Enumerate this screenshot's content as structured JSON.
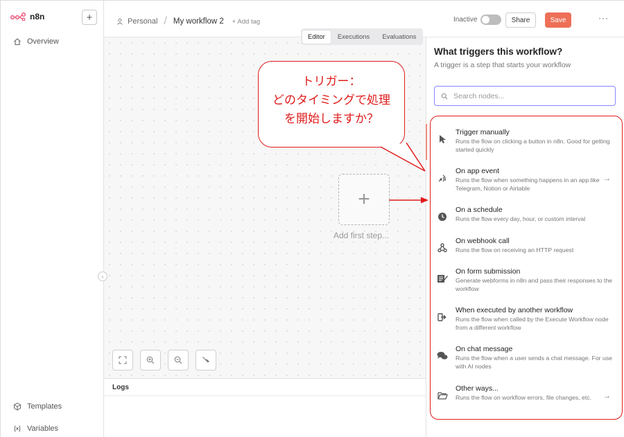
{
  "app": {
    "logo_text": "n8n"
  },
  "sidebar": {
    "items": [
      {
        "label": "Overview"
      },
      {
        "label": "Templates"
      },
      {
        "label": "Variables"
      }
    ]
  },
  "header": {
    "breadcrumb_owner": "Personal",
    "workflow_name": "My workflow 2",
    "add_tag": "+ Add tag",
    "status_label": "Inactive",
    "share_label": "Share",
    "save_label": "Save",
    "more_label": "···"
  },
  "tabs": [
    {
      "label": "Editor",
      "active": true
    },
    {
      "label": "Executions",
      "active": false
    },
    {
      "label": "Evaluations",
      "active": false
    }
  ],
  "canvas": {
    "add_first_step": "Add first step..."
  },
  "logs": {
    "title": "Logs"
  },
  "panel": {
    "title": "What triggers this workflow?",
    "subtitle": "A trigger is a step that starts your workflow",
    "search_placeholder": "Search nodes...",
    "items": [
      {
        "title": "Trigger manually",
        "desc": "Runs the flow on clicking a button in n8n. Good for getting started quickly",
        "icon": "cursor-icon"
      },
      {
        "title": "On app event",
        "desc": "Runs the flow when something happens in an app like Telegram, Notion or Airtable",
        "icon": "satellite-icon"
      },
      {
        "title": "On a schedule",
        "desc": "Runs the flow every day, hour, or custom interval",
        "icon": "clock-icon"
      },
      {
        "title": "On webhook call",
        "desc": "Runs the flow on receiving an HTTP request",
        "icon": "webhook-icon"
      },
      {
        "title": "On form submission",
        "desc": "Generate webforms in n8n and pass their responses to the workflow",
        "icon": "form-icon"
      },
      {
        "title": "When executed by another workflow",
        "desc": "Runs the flow when called by the Execute Workflow node from a different workflow",
        "icon": "sign-in-icon"
      },
      {
        "title": "On chat message",
        "desc": "Runs the flow when a user sends a chat message. For use with AI nodes",
        "icon": "chat-icon"
      },
      {
        "title": "Other ways...",
        "desc": "Runs the flow on workflow errors, file changes, etc.",
        "icon": "folder-icon"
      }
    ]
  },
  "annotation": {
    "line1": "トリガー：",
    "line2": "どのタイミングで処理",
    "line3": "を開始しますか？"
  },
  "colors": {
    "accent": "#ee6f57",
    "annotation": "#e01b1b",
    "search_border": "#8a86ff"
  }
}
